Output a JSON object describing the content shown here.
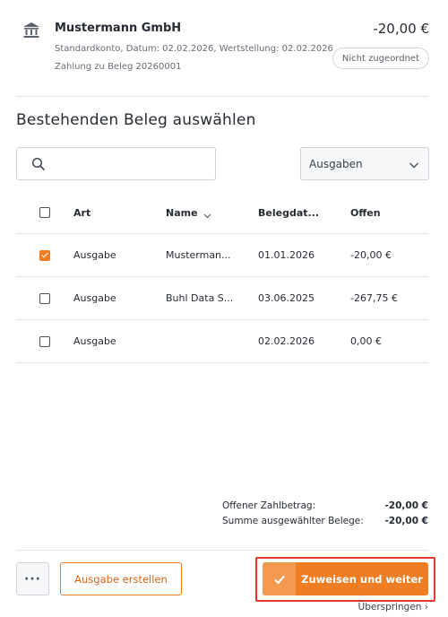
{
  "transaction": {
    "name": "Mustermann GmbH",
    "amount": "-20,00 €",
    "meta_line1": "Standardkonto, Datum: 02.02.2026, Wertstellung: 02.02.2026",
    "meta_line2": "Zahlung zu Beleg 20260001",
    "status_badge": "Nicht zugeordnet",
    "icon": "bank-icon"
  },
  "section": {
    "title": "Bestehenden Beleg auswählen"
  },
  "search": {
    "value": "",
    "placeholder": ""
  },
  "filter": {
    "selected": "Ausgaben"
  },
  "table": {
    "headers": {
      "art": "Art",
      "name": "Name",
      "date": "Belegdat...",
      "open": "Offen"
    },
    "rows": [
      {
        "checked": true,
        "art": "Ausgabe",
        "name": "Musterman...",
        "date": "01.01.2026",
        "open": "-20,00 €"
      },
      {
        "checked": false,
        "art": "Ausgabe",
        "name": "Buhl Data S...",
        "date": "03.06.2025",
        "open": "-267,75 €"
      },
      {
        "checked": false,
        "art": "Ausgabe",
        "name": "",
        "date": "02.02.2026",
        "open": "0,00 €"
      }
    ]
  },
  "totals": {
    "open_label": "Offener Zahlbetrag:",
    "open_value": "-20,00 €",
    "sum_label": "Summe ausgewählter Belege:",
    "sum_value": "-20,00 €"
  },
  "footer": {
    "more_label": "···",
    "create_label": "Ausgabe erstellen",
    "primary_label": "Zuweisen und weiter",
    "skip_label": "Überspringen ›"
  },
  "colors": {
    "accent": "#ef7d23",
    "highlight": "#e0392e"
  }
}
